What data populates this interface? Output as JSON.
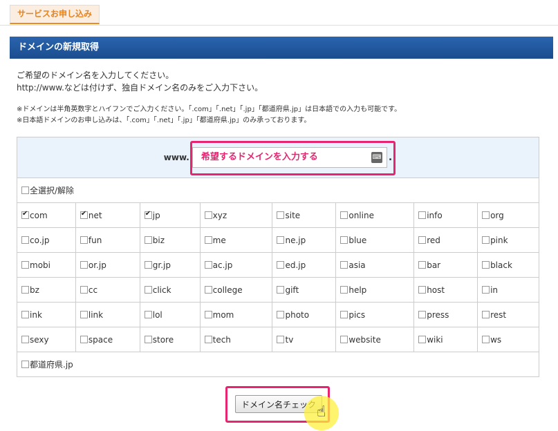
{
  "tab": {
    "label": "サービスお申し込み"
  },
  "section": {
    "title": "ドメインの新規取得"
  },
  "intro": {
    "line1": "ご希望のドメイン名を入力してください。",
    "line2": "http://www.などは付けず、独自ドメイン名のみをご入力下さい。"
  },
  "notes": {
    "line1": "※ドメインは半角英数字とハイフンでご入力ください。「.com」「.net」「.jp」「都道府県.jp」は日本語での入力も可能です。",
    "line2": "※日本語ドメインのお申し込みは、「.com」「.net」「.jp」「都道府県.jp」のみ承っております。"
  },
  "input": {
    "prefix": "www.",
    "placeholder": "希望するドメインを入力する",
    "suffix": "."
  },
  "select_all": {
    "label": "全選択/解除"
  },
  "tlds": [
    [
      {
        "label": "com",
        "checked": true
      },
      {
        "label": "net",
        "checked": true
      },
      {
        "label": "jp",
        "checked": true
      },
      {
        "label": "xyz",
        "checked": false
      },
      {
        "label": "site",
        "checked": false
      },
      {
        "label": "online",
        "checked": false
      },
      {
        "label": "info",
        "checked": false
      },
      {
        "label": "org",
        "checked": false
      }
    ],
    [
      {
        "label": "co.jp",
        "checked": false
      },
      {
        "label": "fun",
        "checked": false
      },
      {
        "label": "biz",
        "checked": false
      },
      {
        "label": "me",
        "checked": false
      },
      {
        "label": "ne.jp",
        "checked": false
      },
      {
        "label": "blue",
        "checked": false
      },
      {
        "label": "red",
        "checked": false
      },
      {
        "label": "pink",
        "checked": false
      }
    ],
    [
      {
        "label": "mobi",
        "checked": false
      },
      {
        "label": "or.jp",
        "checked": false
      },
      {
        "label": "gr.jp",
        "checked": false
      },
      {
        "label": "ac.jp",
        "checked": false
      },
      {
        "label": "ed.jp",
        "checked": false
      },
      {
        "label": "asia",
        "checked": false
      },
      {
        "label": "bar",
        "checked": false
      },
      {
        "label": "black",
        "checked": false
      }
    ],
    [
      {
        "label": "bz",
        "checked": false
      },
      {
        "label": "cc",
        "checked": false
      },
      {
        "label": "click",
        "checked": false
      },
      {
        "label": "college",
        "checked": false
      },
      {
        "label": "gift",
        "checked": false
      },
      {
        "label": "help",
        "checked": false
      },
      {
        "label": "host",
        "checked": false
      },
      {
        "label": "in",
        "checked": false
      }
    ],
    [
      {
        "label": "ink",
        "checked": false
      },
      {
        "label": "link",
        "checked": false
      },
      {
        "label": "lol",
        "checked": false
      },
      {
        "label": "mom",
        "checked": false
      },
      {
        "label": "photo",
        "checked": false
      },
      {
        "label": "pics",
        "checked": false
      },
      {
        "label": "press",
        "checked": false
      },
      {
        "label": "rest",
        "checked": false
      }
    ],
    [
      {
        "label": "sexy",
        "checked": false
      },
      {
        "label": "space",
        "checked": false
      },
      {
        "label": "store",
        "checked": false
      },
      {
        "label": "tech",
        "checked": false
      },
      {
        "label": "tv",
        "checked": false
      },
      {
        "label": "website",
        "checked": false
      },
      {
        "label": "wiki",
        "checked": false
      },
      {
        "label": "ws",
        "checked": false
      }
    ]
  ],
  "prefecture": {
    "label": "都道府県.jp",
    "checked": false
  },
  "button": {
    "label": "ドメイン名チェック"
  },
  "colors": {
    "accent": "#ef8a1c",
    "header": "#1f5699",
    "highlight": "#e6246f"
  }
}
